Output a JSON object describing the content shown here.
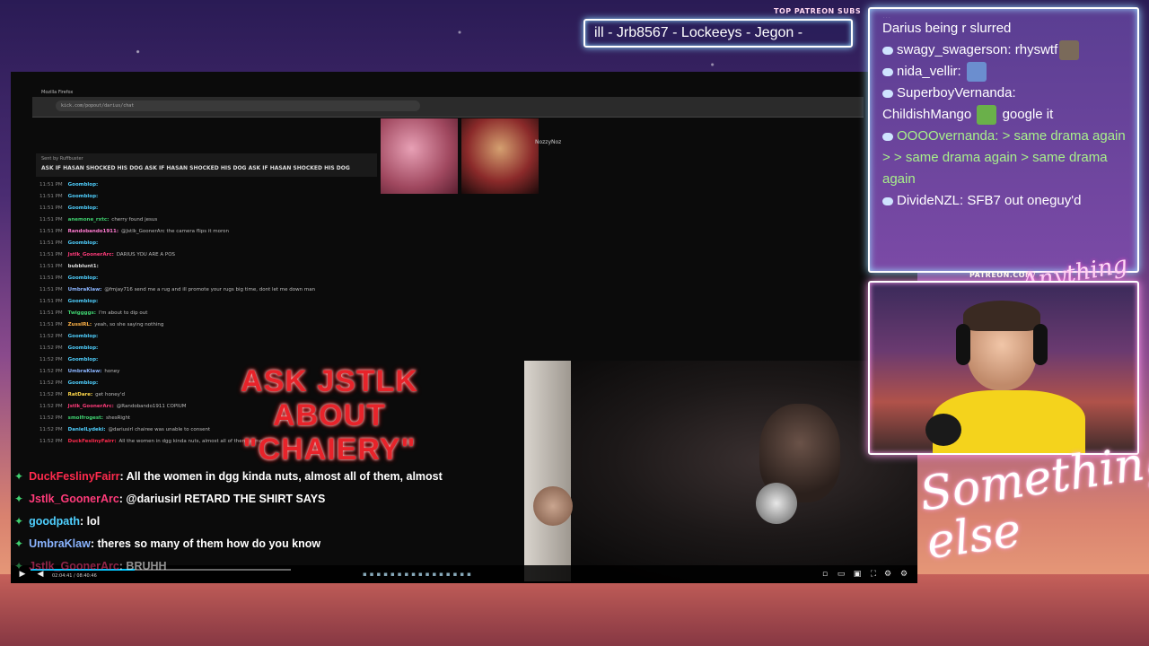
{
  "overlay": {
    "subs_label": "TOP PATREON SUBS",
    "subs_ticker": "ill - Jrb8567 - Lockeeys - Jegon -",
    "patreon_label": "PATREON.COM/",
    "signature": "Anything else",
    "brand": "Something else"
  },
  "browser": {
    "tab_title": "Mozilla Firefox",
    "url": "kick.com/popout/darius/chat"
  },
  "capture": {
    "nozzy_label": "NozzyNoz",
    "banner_top": "Sent by Ruffbuster",
    "banner_text": "ASK IF HASAN SHOCKED HIS DOG  ASK IF HASAN SHOCKED HIS DOG  ASK IF HASAN SHOCKED HIS DOG",
    "chat_lines": [
      {
        "time": "11:51 PM",
        "user": "Goomblop:",
        "msg": ""
      },
      {
        "time": "11:51 PM",
        "user": "Goomblop:",
        "msg": ""
      },
      {
        "time": "11:51 PM",
        "user": "Goomblop:",
        "msg": ""
      },
      {
        "time": "11:51 PM",
        "user": "anemone_rxtc:",
        "msg": "cherry found jesus"
      },
      {
        "time": "11:51 PM",
        "user": "Randobando1911:",
        "msg": "@Jstlk_GoonerArc the camera flips it moron"
      },
      {
        "time": "11:51 PM",
        "user": "Goomblop:",
        "msg": ""
      },
      {
        "time": "11:51 PM",
        "user": "Jstlk_GoonerArc:",
        "msg": "DARIUS YOU ARE A POS"
      },
      {
        "time": "11:51 PM",
        "user": "bubblunt1:",
        "msg": ""
      },
      {
        "time": "11:51 PM",
        "user": "Goomblop:",
        "msg": ""
      },
      {
        "time": "11:51 PM",
        "user": "UmbraKlaw:",
        "msg": "@fmjay716 send me a rug and ill promote your rugs big time, dont let me down man"
      },
      {
        "time": "11:51 PM",
        "user": "Goomblop:",
        "msg": ""
      },
      {
        "time": "11:51 PM",
        "user": "Twiggggs:",
        "msg": "I'm about to dip out"
      },
      {
        "time": "11:51 PM",
        "user": "ZussIRL:",
        "msg": "yeah, so she saying nothing"
      },
      {
        "time": "11:52 PM",
        "user": "Goomblop:",
        "msg": ""
      },
      {
        "time": "11:52 PM",
        "user": "Goomblop:",
        "msg": ""
      },
      {
        "time": "11:52 PM",
        "user": "Goomblop:",
        "msg": ""
      },
      {
        "time": "11:52 PM",
        "user": "UmbraKlaw:",
        "msg": "honey"
      },
      {
        "time": "11:52 PM",
        "user": "Goomblop:",
        "msg": ""
      },
      {
        "time": "11:52 PM",
        "user": "RatDare:",
        "msg": "get honey'd"
      },
      {
        "time": "11:52 PM",
        "user": "Jstlk_GoonerArc:",
        "msg": "@Randobando1911 COPIUM"
      },
      {
        "time": "11:52 PM",
        "user": "smolfrogest:",
        "msg": "shesRight"
      },
      {
        "time": "11:52 PM",
        "user": "DanielLydeki:",
        "msg": "@dariusirl chairee was unable to consent"
      },
      {
        "time": "11:52 PM",
        "user": "DuckFeslinyFairr:",
        "msg": "All the women in dgg kinda nuts, almost all of them, almost"
      }
    ],
    "ask_text_1": "ASK JSTLK",
    "ask_text_2": "ABOUT",
    "ask_text_3": "\"CHAIERY\"",
    "player_time": "02:04:41 / 08:40:46"
  },
  "overlay_chat": [
    {
      "user": "DuckFeslinyFairr",
      "user_color": "#ff2a4d",
      "msg": ": All the women in dgg kinda nuts, almost all of them, almost"
    },
    {
      "user": "Jstlk_GoonerArc",
      "user_color": "#ff3b7a",
      "msg": ": @dariusirl RETARD THE SHIRT SAYS"
    },
    {
      "user": "goodpath",
      "user_color": "#4fd0ff",
      "msg": ": lol"
    },
    {
      "user": "UmbraKlaw",
      "user_color": "#8ab4ff",
      "msg": ": theres so many of them how do you know"
    },
    {
      "user": "Jstlk_GoonerArc",
      "user_color": "#ff3b7a",
      "msg": ": BRUHH"
    }
  ],
  "right_chat": [
    {
      "user": "",
      "msg": "Darius being r slurred"
    },
    {
      "user": "swagy_swagerson:",
      "msg": "rhyswtf"
    },
    {
      "user": "nida_vellir:",
      "msg": ""
    },
    {
      "user": "SuperboyVernanda:",
      "msg": "ChildishMango"
    },
    {
      "user": "",
      "msg": "google it"
    },
    {
      "user": "OOOOvernanda:",
      "msg": "> same drama again"
    },
    {
      "user": "",
      "msg": "> > same drama again > same drama again"
    },
    {
      "user": "DivideNZL:",
      "msg": "SFB7 out oneguy'd"
    }
  ],
  "colors": {
    "accent_cyan": "#8ad7ff",
    "accent_pink": "#ff9af0",
    "ask_red": "#e8232a",
    "badge_green": "#3fd06f"
  }
}
